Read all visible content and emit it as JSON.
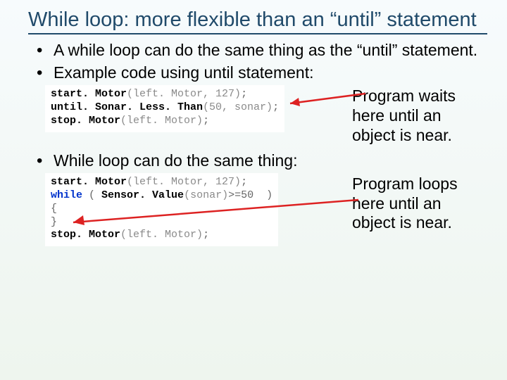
{
  "title": "While loop: more flexible than an “until” statement",
  "bullets": {
    "b1": "A while loop can do the same thing as the “until” statement.",
    "b2": "Example code using until statement:",
    "b3": "While loop can do the same thing:"
  },
  "code1": {
    "l1_fn": "start. Motor",
    "l1_args": "(left. Motor, 127)",
    "l1_end": ";",
    "l2_fn": "until. Sonar. Less. Than",
    "l2_args": "(50, sonar)",
    "l2_end": ";",
    "l3_fn": "stop. Motor",
    "l3_args": "(left. Motor)",
    "l3_end": ";"
  },
  "annot1": "Program waits here until an object is near.",
  "code2": {
    "l1_fn": "start. Motor",
    "l1_args": "(left. Motor, 127)",
    "l1_end": ";",
    "l2_kw": "while",
    "l2_open": " ( ",
    "l2_fn": "Sensor. Value",
    "l2_args": "(sonar)",
    "l2_cmp": ">=50 ",
    "l2_close": " )",
    "l3": "{",
    "l4": "}",
    "l5_fn": "stop. Motor",
    "l5_args": "(left. Motor)",
    "l5_end": ";"
  },
  "annot2": "Program loops here until an object is near."
}
